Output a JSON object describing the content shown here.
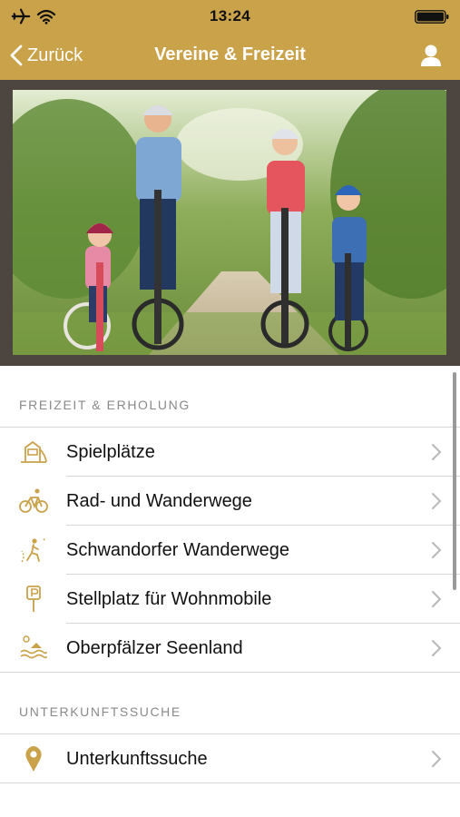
{
  "status_bar": {
    "time": "13:24"
  },
  "nav": {
    "back_label": "Zurück",
    "title": "Vereine & Freizeit"
  },
  "colors": {
    "accent": "#c9a24a",
    "icon_gold": "#c9a24a",
    "hero_frame": "#4d4540"
  },
  "sections": [
    {
      "header": "FREIZEIT & ERHOLUNG",
      "items": [
        {
          "label": "Spielplätze",
          "icon": "playground-icon"
        },
        {
          "label": "Rad- und Wanderwege",
          "icon": "bicycle-icon"
        },
        {
          "label": "Schwandorfer Wanderwege",
          "icon": "hiking-icon"
        },
        {
          "label": "Stellplatz für Wohnmobile",
          "icon": "parking-sign-icon"
        },
        {
          "label": "Oberpfälzer Seenland",
          "icon": "lake-icon"
        }
      ]
    },
    {
      "header": "UNTERKUNFTSSUCHE",
      "items": [
        {
          "label": "Unterkunftssuche",
          "icon": "location-pin-icon"
        }
      ]
    }
  ]
}
